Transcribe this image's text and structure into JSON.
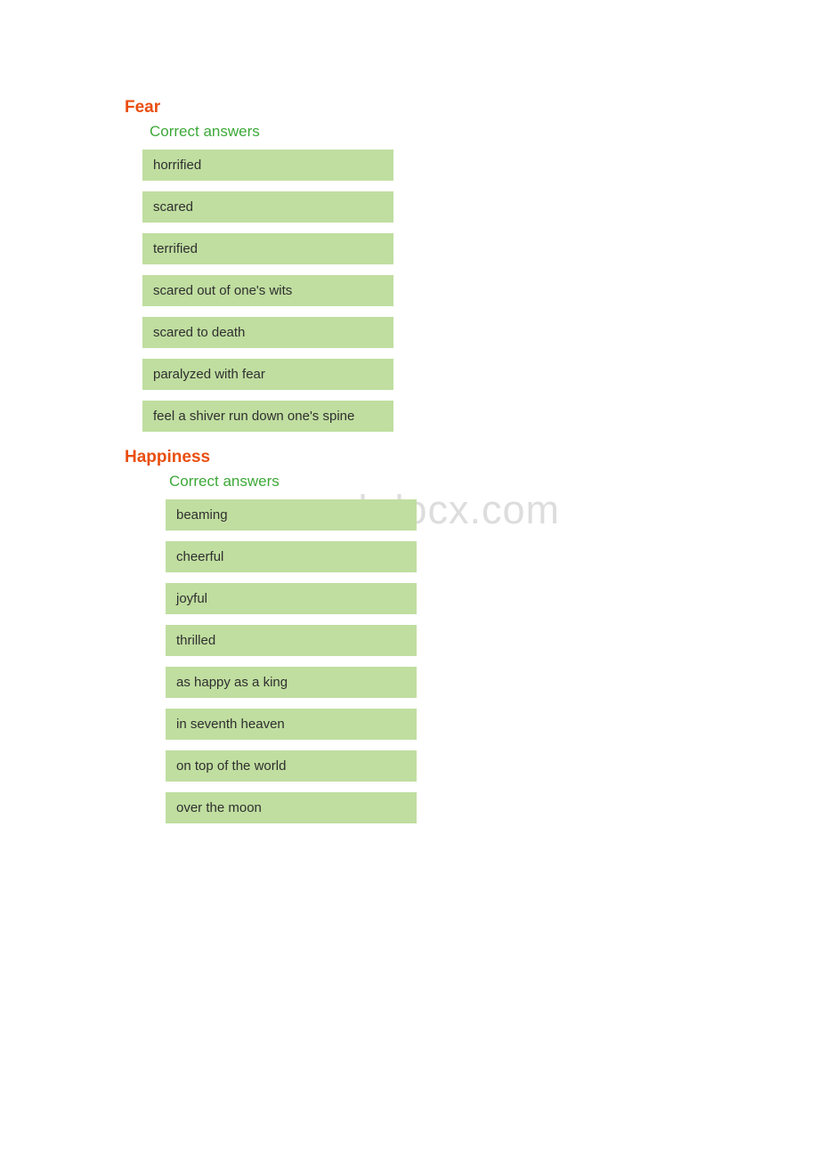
{
  "sections": [
    {
      "title": "Fear",
      "label": "Correct answers",
      "answers": [
        "horrified",
        "scared",
        "terrified",
        "scared out of one's wits",
        "scared to death",
        "paralyzed with fear",
        "feel a shiver run down one's spine"
      ]
    },
    {
      "title": "Happiness",
      "label": "Correct answers",
      "answers": [
        "beaming",
        "cheerful",
        "joyful",
        "thrilled",
        "as happy as a king",
        "in seventh heaven",
        "on top of the world",
        "over the moon"
      ]
    }
  ],
  "watermark": "www.bdocx.com"
}
